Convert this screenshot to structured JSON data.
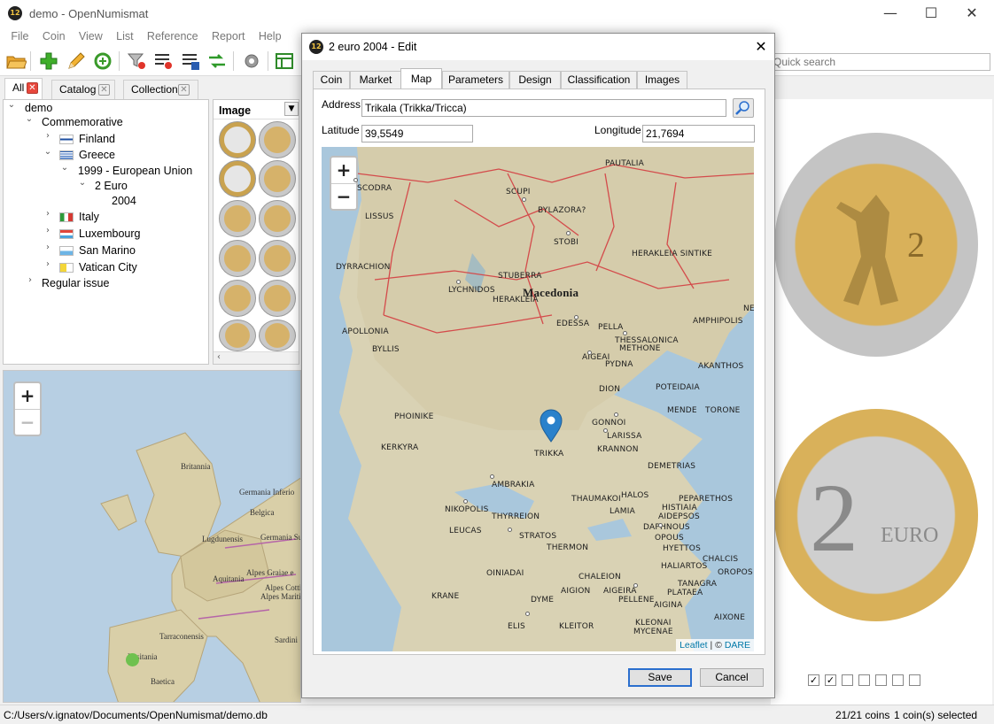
{
  "main": {
    "title": "demo - OpenNumismat",
    "app_icon": "12",
    "menu": [
      "File",
      "Coin",
      "View",
      "List",
      "Reference",
      "Report",
      "Help"
    ],
    "quick_search_placeholder": "Quick search",
    "list_tabs": [
      {
        "label": "All",
        "active": true
      },
      {
        "label": "Catalog",
        "active": false
      },
      {
        "label": "Collection",
        "active": false
      }
    ],
    "tree": {
      "root": "demo",
      "commemorative": "Commemorative",
      "finland": "Finland",
      "greece": "Greece",
      "year_group": "1999 - European Union",
      "denomination": "2 Euro",
      "year": "2004",
      "italy": "Italy",
      "luxembourg": "Luxembourg",
      "san_marino": "San Marino",
      "vatican": "Vatican City",
      "regular": "Regular issue"
    },
    "image_header": "Image",
    "map_labels": {
      "britannia": "Britannia",
      "germania_inferior": "Germania Inferio",
      "belgica": "Belgica",
      "lugdunensis": "Lugdunensis",
      "germania_superior": "Germania Superio",
      "aquitania": "Aquitania",
      "alpes_graiae": "Alpes Graiae e",
      "alpes_cottiae": "Alpes Cotti",
      "alpes_maritimae": "Alpes Maritim",
      "tarraconensis": "Tarraconensis",
      "lusitania": "Lusitania",
      "baetica": "Baetica",
      "sardinia": "Sardini"
    },
    "checkboxes": [
      true,
      true,
      false,
      false,
      false,
      false,
      false
    ],
    "status": {
      "path": "C:/Users/v.ignatov/Documents/OpenNumismat/demo.db",
      "count": "21/21 coins",
      "selected": "1 coin(s) selected"
    }
  },
  "dialog": {
    "title": "2 euro 2004 - Edit",
    "tabs": [
      "Coin",
      "Market",
      "Map",
      "Parameters",
      "Design",
      "Classification",
      "Images"
    ],
    "active_tab": "Map",
    "address_label": "Address",
    "address_value": "Trikala (Trikka/Tricca)",
    "latitude_label": "Latitude",
    "latitude_value": "39,5549",
    "longitude_label": "Longitude",
    "longitude_value": "21,7694",
    "map": {
      "region_label": "Macedonia",
      "marker_label": "TRIKKA",
      "cities": [
        "PAUTALIA",
        "SCODRA",
        "SCUPI",
        "BYLAZORA?",
        "LISSUS",
        "STOBI",
        "HERAKLEIA SINTIKE",
        "DYRRACHION",
        "STUBERRA",
        "LYCHNIDOS",
        "HERAKLEIA",
        "APOLLONIA",
        "EDESSA",
        "PELLA",
        "AMPHIPOLIS",
        "NE",
        "THESSALONICA",
        "METHONE",
        "BYLLIS",
        "AIGEAI",
        "PYDNA",
        "AKANTHOS",
        "DION",
        "POTEIDAIA",
        "MENDE",
        "TORONE",
        "PHOINIKE",
        "GONNOI",
        "LARISSA",
        "KERKYRA",
        "KRANNON",
        "DEMETRIAS",
        "AMBRAKIA",
        "THAUMAKOI",
        "HALOS",
        "PEPARETHOS",
        "HISTIAIA",
        "NIKOPOLIS",
        "LAMIA",
        "AIDEPSOS",
        "THYRREION",
        "LEUCAS",
        "DAPHNOUS",
        "STRATOS",
        "OPOUS",
        "THERMON",
        "HYETTOS",
        "CHALCIS",
        "HALIARTOS",
        "OROPOS",
        "OINIADAI",
        "CHALEION",
        "TANAGRA",
        "AIGION",
        "AIGEIRA",
        "PLATAEA",
        "KRANE",
        "DYME",
        "PELLENE",
        "AIGINA",
        "AIXONE",
        "KLEONAI",
        "MYCENAE",
        "ELIS",
        "KLEITOR"
      ],
      "attribution_link": "Leaflet",
      "attribution_sep": " | © ",
      "attribution_source": "DARE"
    },
    "save_label": "Save",
    "cancel_label": "Cancel"
  },
  "colors": {
    "accent": "#2b6fce",
    "close_tab": "#e8473c",
    "marker": "#2a81cb",
    "sea": "#b7cfe3",
    "land": "#d9d2b4"
  }
}
